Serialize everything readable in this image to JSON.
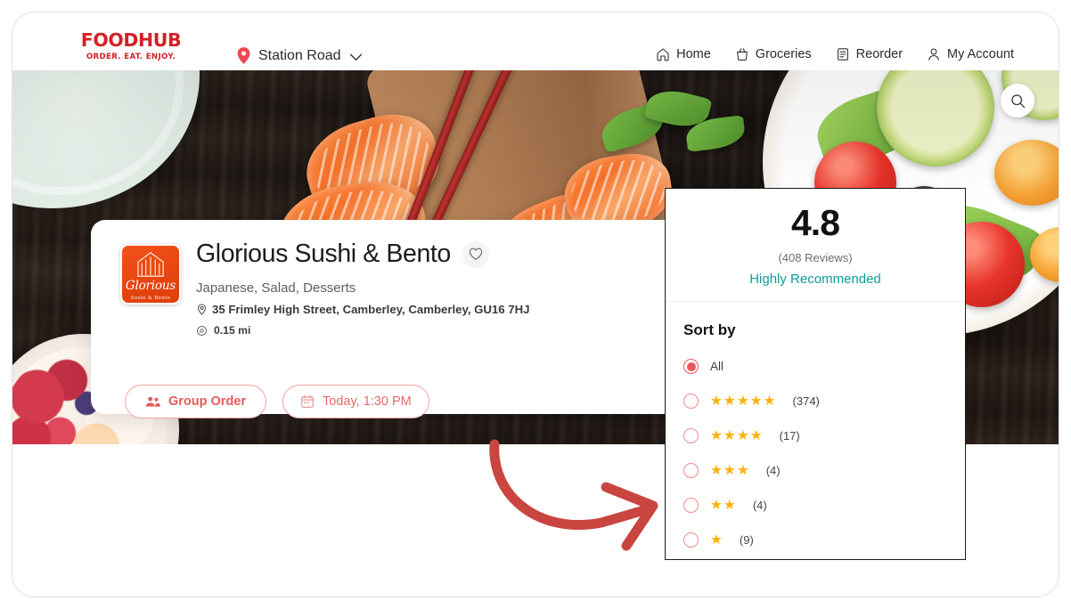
{
  "header": {
    "logo_word": "FOODHUB",
    "logo_tagline": "ORDER. EAT. ENJOY.",
    "location": "Station Road",
    "nav": [
      {
        "label": "Home",
        "icon": "home-icon"
      },
      {
        "label": "Groceries",
        "icon": "basket-icon"
      },
      {
        "label": "Reorder",
        "icon": "receipt-icon"
      },
      {
        "label": "My Account",
        "icon": "person-icon"
      }
    ]
  },
  "hero": {
    "search_icon": "search-icon"
  },
  "restaurant": {
    "logo_name": "Glorious",
    "logo_sub": "Sushi & Bento",
    "title": "Glorious Sushi & Bento",
    "favorite_icon": "heart-icon",
    "cuisines": "Japanese, Salad, Desserts",
    "address": "35 Frimley High Street, Camberley, Camberley, GU16 7HJ",
    "distance": "0.15 mi",
    "actions": [
      {
        "label": "Group Order",
        "icon": "group-icon"
      },
      {
        "label": "Today, 1:30 PM",
        "icon": "calendar-icon"
      }
    ]
  },
  "ratings": {
    "score": "4.8",
    "reviews": "(408 Reviews)",
    "recommendation": "Highly Recommended",
    "sort_title": "Sort by",
    "options": [
      {
        "label": "All",
        "stars": 0,
        "count": "",
        "selected": true
      },
      {
        "label": "",
        "stars": 5,
        "count": "(374)",
        "selected": false
      },
      {
        "label": "",
        "stars": 4,
        "count": "(17)",
        "selected": false
      },
      {
        "label": "",
        "stars": 3,
        "count": "(4)",
        "selected": false
      },
      {
        "label": "",
        "stars": 2,
        "count": "(4)",
        "selected": false
      },
      {
        "label": "",
        "stars": 1,
        "count": "(9)",
        "selected": false
      }
    ]
  },
  "annotation": {
    "arrow_color": "#c9453f"
  },
  "colors": {
    "brand_red": "#d32027",
    "accent_pink": "#e8595c",
    "teal": "#0f9b9b",
    "star_gold": "#ffb109",
    "logo_orange": "#e8450f"
  }
}
